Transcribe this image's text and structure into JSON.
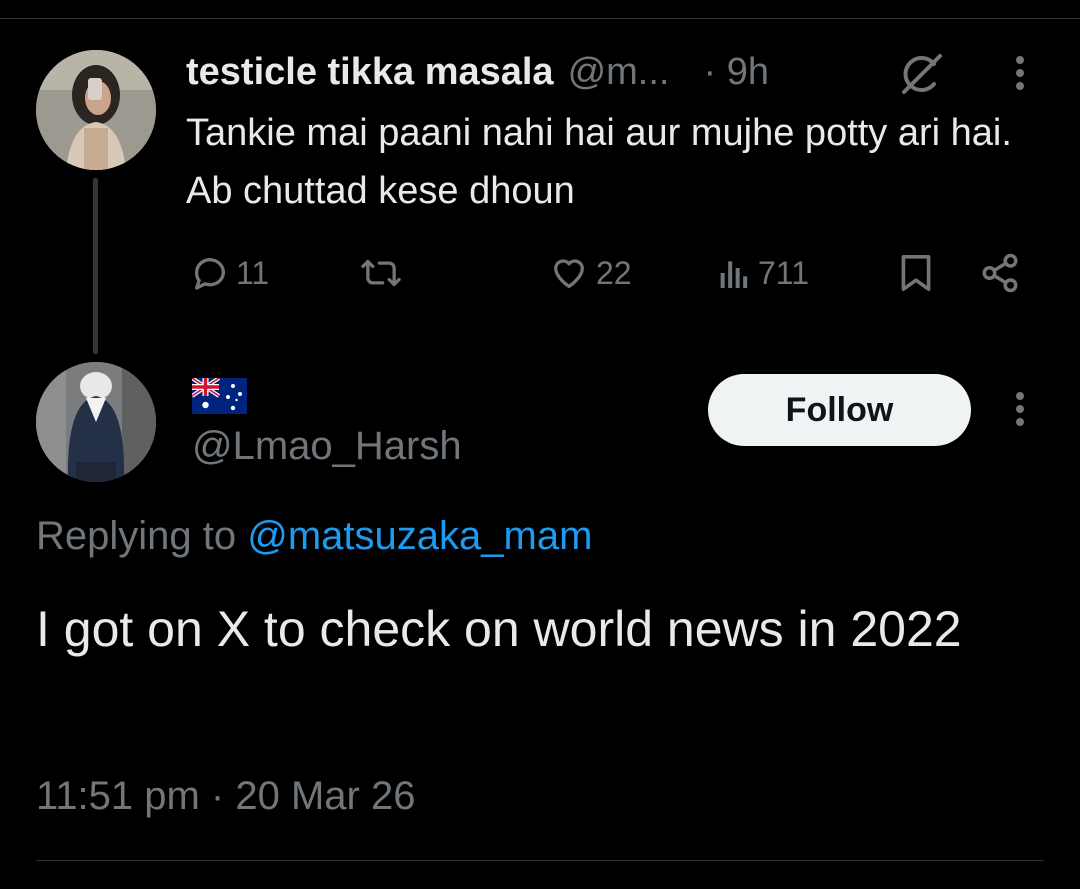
{
  "parent_tweet": {
    "display_name": "testicle tikka masala",
    "handle_truncated": "@m...",
    "time": "· 9h",
    "text": "Tankie mai paani nahi hai aur mujhe potty ari hai. Ab chuttad kese dhoun",
    "stats": {
      "replies": "11",
      "likes": "22",
      "views": "711"
    },
    "avatar_icon": "profile-avatar",
    "grok_icon": "grok-icon"
  },
  "reply_tweet": {
    "display_name_flag": "australia-flag",
    "handle": "@Lmao_Harsh",
    "follow_label": "Follow",
    "replying_prefix": "Replying to",
    "replying_handle": "@matsuzaka_mam",
    "text": "I got on X to check on world news in 2022",
    "timestamp": "11:51 pm · 20 Mar 26"
  },
  "colors": {
    "background": "#000000",
    "text": "#e7e9ea",
    "secondary": "#71767b",
    "accent": "#1d9bf0",
    "follow_bg": "#eff3f4"
  }
}
